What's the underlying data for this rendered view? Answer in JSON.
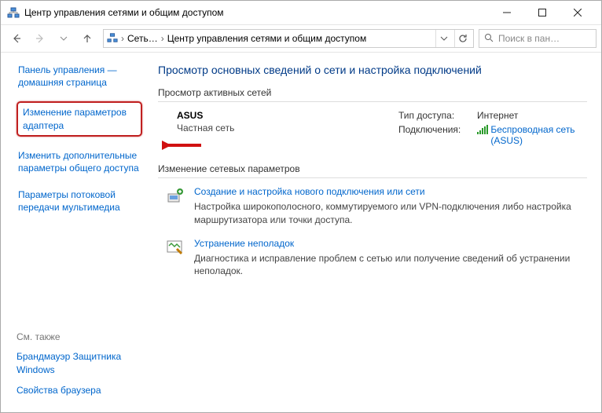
{
  "window": {
    "title": "Центр управления сетями и общим доступом"
  },
  "toolbar": {
    "crumbs": [
      "Сеть…",
      "Центр управления сетями и общим доступом"
    ],
    "search_placeholder": "Поиск в пан…"
  },
  "sidebar": {
    "cp_home": "Панель управления — домашняя страница",
    "links": [
      "Изменение параметров адаптера",
      "Изменить дополнительные параметры общего доступа",
      "Параметры потоковой передачи мультимедиа"
    ],
    "see_also": {
      "header": "См. также",
      "links": [
        "Брандмауэр Защитника Windows",
        "Свойства браузера"
      ]
    }
  },
  "main": {
    "heading": "Просмотр основных сведений о сети и настройка подключений",
    "active_section": "Просмотр активных сетей",
    "network": {
      "name": "ASUS",
      "type": "Частная сеть",
      "access_label": "Тип доступа:",
      "access_value": "Интернет",
      "conn_label": "Подключения:",
      "conn_value": "Беспроводная сеть (ASUS)"
    },
    "params_section": "Изменение сетевых параметров",
    "options": [
      {
        "title": "Создание и настройка нового подключения или сети",
        "desc": "Настройка широкополосного, коммутируемого или VPN-подключения либо настройка маршрутизатора или точки доступа."
      },
      {
        "title": "Устранение неполадок",
        "desc": "Диагностика и исправление проблем с сетью или получение сведений об устранении неполадок."
      }
    ]
  }
}
